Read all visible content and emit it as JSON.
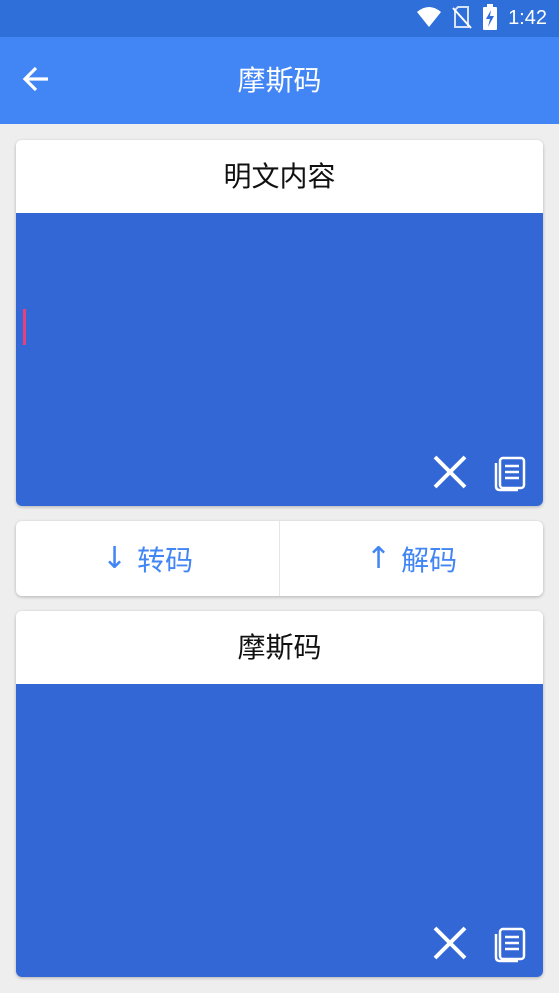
{
  "status_bar": {
    "time": "1:42",
    "icons": [
      "wifi-icon",
      "no-sim-icon",
      "battery-charging-icon"
    ]
  },
  "app_bar": {
    "title": "摩斯码",
    "back_icon": "arrow-left-icon"
  },
  "plain_card": {
    "title": "明文内容",
    "value": "",
    "clear_icon": "close-icon",
    "copy_icon": "copy-icon"
  },
  "actions": {
    "encode_label": "转码",
    "encode_icon": "arrow-down-icon",
    "encode_arrow": "↓",
    "decode_label": "解码",
    "decode_icon": "arrow-up-icon",
    "decode_arrow": "↑"
  },
  "morse_card": {
    "title": "摩斯码",
    "value": "",
    "clear_icon": "close-icon",
    "copy_icon": "copy-icon"
  },
  "colors": {
    "status_bar": "#2f6fd9",
    "app_bar": "#4285f4",
    "input_area": "#3367d6",
    "accent_text": "#4285f4",
    "caret": "#e8407a",
    "background": "#eeeeee"
  }
}
